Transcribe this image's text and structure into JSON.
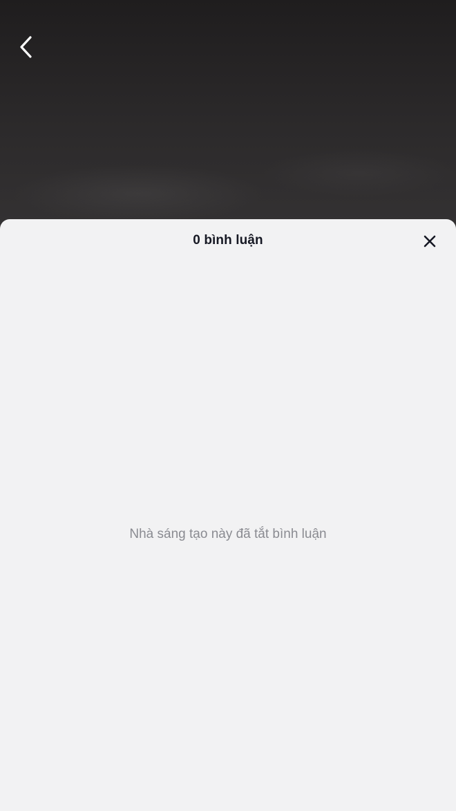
{
  "header": {
    "back_icon": "chevron-left-icon"
  },
  "comments_sheet": {
    "title": "0 bình luận",
    "close_icon": "close-icon",
    "empty_message": "Nhà sáng tạo này đã tắt bình luận"
  },
  "colors": {
    "sheet_background": "#f2f2f3",
    "title_text": "#161823",
    "empty_text": "#8a8b91",
    "video_background": "#2a2829"
  }
}
